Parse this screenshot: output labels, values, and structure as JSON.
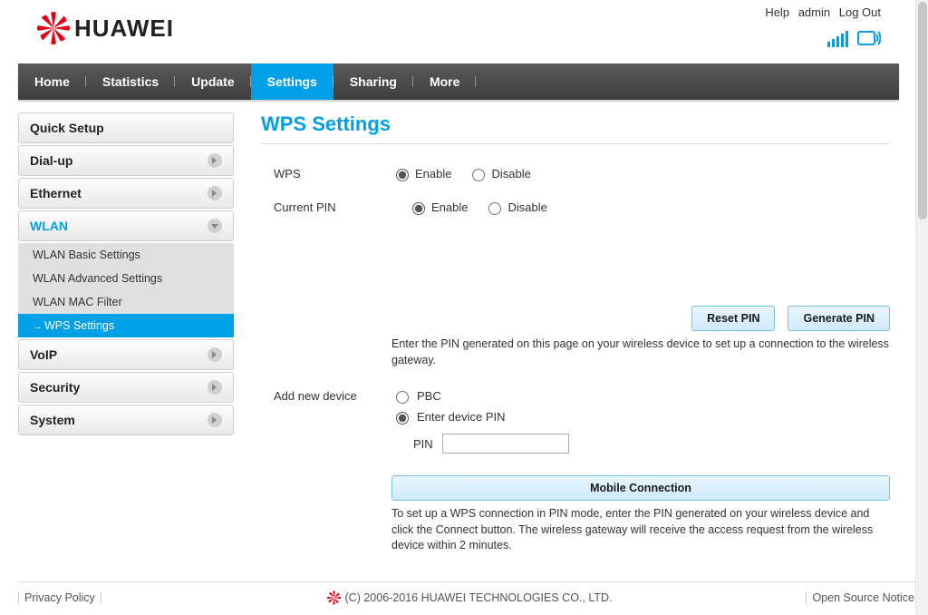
{
  "top_links": {
    "help": "Help",
    "user": "admin",
    "logout": "Log Out"
  },
  "brand": "HUAWEI",
  "nav": {
    "home": "Home",
    "statistics": "Statistics",
    "update": "Update",
    "settings": "Settings",
    "sharing": "Sharing",
    "more": "More"
  },
  "sidebar": {
    "quick_setup": "Quick Setup",
    "dial_up": "Dial-up",
    "ethernet": "Ethernet",
    "wlan": "WLAN",
    "wlan_sub": {
      "basic": "WLAN Basic Settings",
      "advanced": "WLAN Advanced Settings",
      "mac": "WLAN MAC Filter",
      "wps": "WPS Settings"
    },
    "voip": "VoIP",
    "security": "Security",
    "system": "System"
  },
  "page": {
    "title": "WPS Settings",
    "wps_label": "WPS",
    "wps_enable": "Enable",
    "wps_disable": "Disable",
    "pin_label": "Current PIN",
    "pin_enable": "Enable",
    "pin_disable": "Disable",
    "reset_pin_btn": "Reset PIN",
    "generate_pin_btn": "Generate PIN",
    "pin_note": "Enter the PIN generated on this page on your wireless device to set up a connection to the wireless gateway.",
    "add_label": "Add new device",
    "add_pbc": "PBC",
    "add_enter_pin": "Enter device PIN",
    "pin_field_label": "PIN",
    "pin_value": "",
    "connect_btn": "Mobile Connection",
    "connect_note": "To set up a WPS connection in PIN mode, enter the PIN generated on your wireless device and click the Connect button. The wireless gateway will receive the access request from the wireless device within 2 minutes."
  },
  "footer": {
    "privacy": "Privacy Policy",
    "copyright": "(C) 2006-2016 HUAWEI TECHNOLOGIES CO., LTD.",
    "open_source": "Open Source Notice"
  }
}
